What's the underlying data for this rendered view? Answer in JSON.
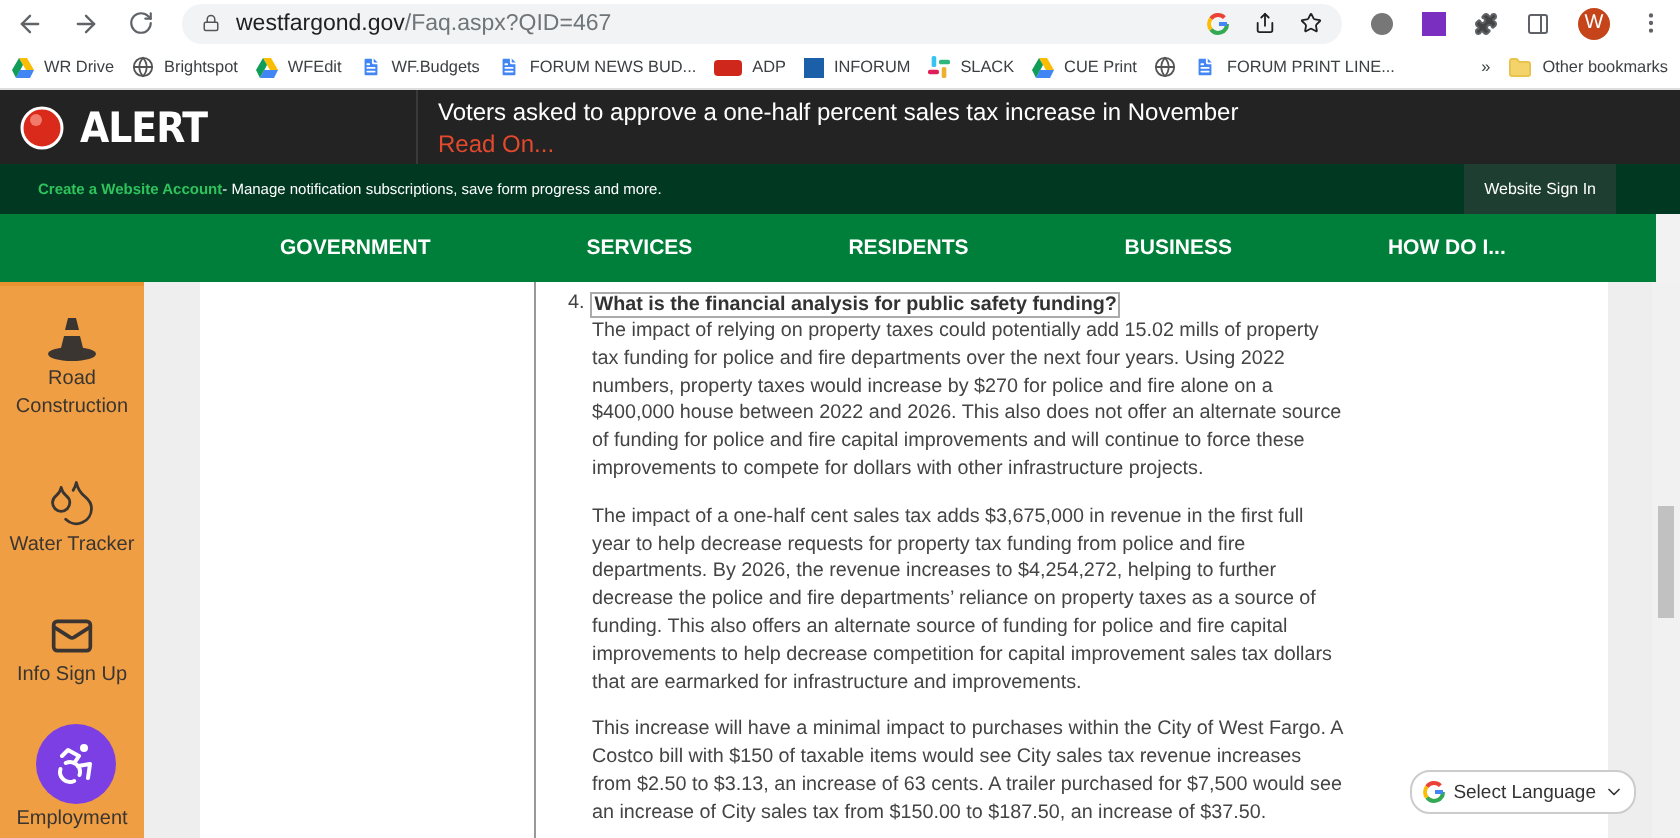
{
  "browser": {
    "url_host": "westfargond.gov",
    "url_path": "/Faq.aspx?QID=467",
    "profile_initial": "W",
    "bookmarks": [
      {
        "label": "WR Drive",
        "kind": "drive"
      },
      {
        "label": "Brightspot",
        "kind": "globe"
      },
      {
        "label": "WFEdit",
        "kind": "drive"
      },
      {
        "label": "WF.Budgets",
        "kind": "doc"
      },
      {
        "label": "FORUM NEWS BUD...",
        "kind": "doc"
      },
      {
        "label": "ADP",
        "kind": "adp"
      },
      {
        "label": "INFORUM",
        "kind": "inforum"
      },
      {
        "label": "SLACK",
        "kind": "slack"
      },
      {
        "label": "CUE Print",
        "kind": "drive"
      },
      {
        "kind": "globe"
      },
      {
        "label": "FORUM PRINT LINE...",
        "kind": "doc"
      }
    ],
    "more": "»",
    "other_bookmarks": "Other bookmarks"
  },
  "alert": {
    "label": "ALERT",
    "headline": "Voters asked to approve a one-half percent sales tax increase in November",
    "link": "Read On..."
  },
  "account": {
    "link": "Create a Website Account",
    "text": " - Manage notification subscriptions, save form progress and more.",
    "sign_in": "Website Sign In"
  },
  "nav": [
    "GOVERNMENT",
    "SERVICES",
    "RESIDENTS",
    "BUSINESS",
    "HOW DO I..."
  ],
  "sidebar": [
    {
      "label": "Road Construction",
      "kind": "cone"
    },
    {
      "label": "Water Tracker",
      "kind": "drops"
    },
    {
      "label": "Info Sign Up",
      "kind": "mail"
    },
    {
      "label": "Employment",
      "kind": "none"
    }
  ],
  "faq": {
    "number": "4.",
    "question": "What is the financial analysis for public safety funding?",
    "paragraphs": [
      "The impact of relying on property taxes could potentially add 15.02 mills of property tax funding for police and fire departments over the next four years. Using 2022 numbers, property taxes would increase by $270 for police and fire alone on a $400,000 house between 2022 and 2026. This also does not offer an alternate source of funding for police and fire capital improvements and will continue to force these improvements to compete for dollars with other infrastructure projects.",
      "The impact of a one-half cent sales tax adds $3,675,000 in revenue in the first full year to help decrease requests for property tax funding from police and fire departments. By 2026, the revenue increases to $4,254,272, helping to further decrease the police and fire departments’ reliance on property taxes as a source of funding. This also offers an alternate source of funding for police and fire capital improvements to help decrease competition for capital improvement sales tax dollars that are earmarked for infrastructure and improvements.",
      "This increase will have a minimal impact to purchases within the City of West Fargo. A Costco bill with $150 of taxable items would see City sales tax revenue increases from $2.50 to $3.13, an increase of 63 cents. A trailer purchased for $7,500 would see an increase of City sales tax from $150.00 to $187.50, an increase of $37.50."
    ]
  },
  "translate": {
    "label": "Select Language"
  }
}
